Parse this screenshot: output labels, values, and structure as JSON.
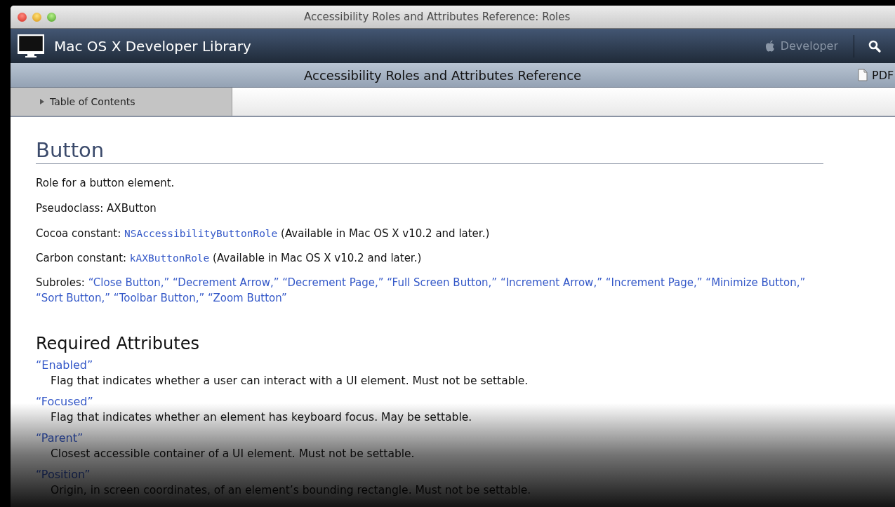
{
  "window": {
    "title": "Accessibility Roles and Attributes Reference: Roles"
  },
  "navbar": {
    "title": "Mac OS X Developer Library",
    "developer_link": "Developer"
  },
  "book_bar": {
    "title": "Accessibility Roles and Attributes Reference",
    "pdf_label": "PDF"
  },
  "toc": {
    "label": "Table of Contents",
    "expanded": false
  },
  "content": {
    "heading": "Button",
    "paragraphs": [
      "Role for a button element.",
      "Pseudoclass: AXButton"
    ],
    "constants": [
      {
        "label": "Cocoa constant:",
        "code": "NSAccessibilityButtonRole",
        "note": "(Available in Mac OS X v10.2 and later.)"
      },
      {
        "label": "Carbon constant:",
        "code": "kAXButtonRole",
        "note": "(Available in Mac OS X v10.2 and later.)"
      }
    ],
    "subroles": {
      "label": "Subroles:",
      "items": [
        "“Close Button,”",
        "“Decrement Arrow,”",
        "“Decrement Page,”",
        "“Full Screen Button,”",
        "“Increment Arrow,”",
        "“Increment Page,”",
        "“Minimize Button,”",
        "“Sort Button,”",
        "“Toolbar Button,”",
        "“Zoom Button”"
      ]
    },
    "section_heading": "Required Attributes",
    "attributes": [
      {
        "name": "“Enabled”",
        "description": "Flag that indicates whether a user can interact with a UI element. Must not be settable."
      },
      {
        "name": "“Focused”",
        "description": "Flag that indicates whether an element has keyboard focus. May be settable."
      },
      {
        "name": "“Parent”",
        "description": "Closest accessible container of a UI element. Must not be settable."
      },
      {
        "name": "“Position”",
        "description": "Origin, in screen coordinates, of an element’s bounding rectangle. Must not be settable."
      }
    ]
  }
}
